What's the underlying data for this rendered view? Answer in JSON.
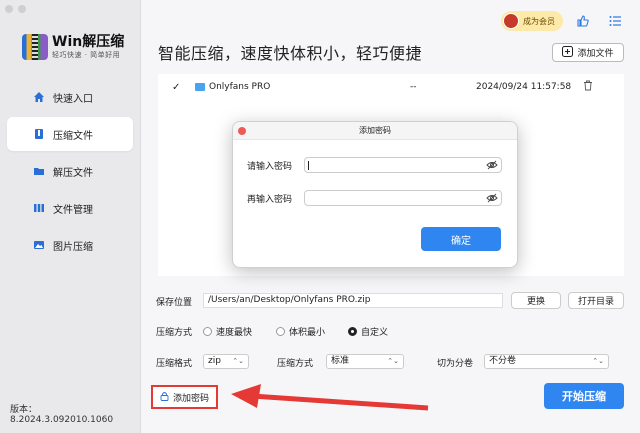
{
  "app": {
    "name": "Win解压缩",
    "tagline": "轻巧快速 · 简单好用",
    "version": "版本：8.2024.3.092010.1060"
  },
  "sidebar": {
    "items": [
      {
        "label": "快速入口",
        "icon": "home-icon"
      },
      {
        "label": "压缩文件",
        "icon": "archive-icon",
        "active": true
      },
      {
        "label": "解压文件",
        "icon": "folder-icon"
      },
      {
        "label": "文件管理",
        "icon": "files-icon"
      },
      {
        "label": "图片压缩",
        "icon": "image-icon"
      }
    ]
  },
  "header": {
    "title": "智能压缩，速度快体积小，轻巧便捷",
    "vip_label": "成为会员",
    "add_file_label": "添加文件"
  },
  "file_list": [
    {
      "checked": true,
      "name": "Onlyfans PRO",
      "size": "--",
      "date": "2024/09/24 11:57:58"
    }
  ],
  "dialog": {
    "title": "添加密码",
    "password_label": "请输入密码",
    "confirm_label": "再输入密码",
    "ok_label": "确定"
  },
  "options": {
    "save_location_label": "保存位置",
    "save_path": "/Users/an/Desktop/Onlyfans PRO.zip",
    "change_label": "更换",
    "open_dir_label": "打开目录",
    "compress_mode_label": "压缩方式",
    "modes": [
      "速度最快",
      "体积最小",
      "自定义"
    ],
    "selected_mode": "自定义",
    "format_label": "压缩格式",
    "format_value": "zip",
    "method_label": "压缩方式",
    "method_value": "标准",
    "split_label": "切为分卷",
    "split_value": "不分卷"
  },
  "footer": {
    "add_password_label": "添加密码",
    "start_label": "开始压缩"
  },
  "colors": {
    "accent": "#2f86f0",
    "highlight": "#e53935"
  }
}
